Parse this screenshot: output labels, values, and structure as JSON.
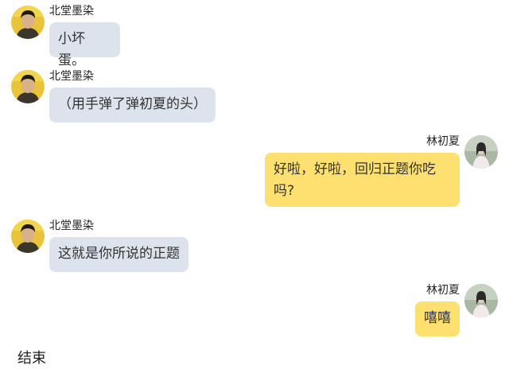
{
  "messages": [
    {
      "side": "left",
      "sender": "北堂墨染",
      "text": "小坏蛋。",
      "avatar_icon": "male-avatar-icon"
    },
    {
      "side": "left",
      "sender": "北堂墨染",
      "text": "（用手弹了弹初夏的头）",
      "avatar_icon": "male-avatar-icon"
    },
    {
      "side": "right",
      "sender": "林初夏",
      "text": "好啦，好啦，回归正题你吃吗?",
      "avatar_icon": "female-avatar-icon"
    },
    {
      "side": "left",
      "sender": "北堂墨染",
      "text": "这就是你所说的正题",
      "avatar_icon": "male-avatar-icon"
    },
    {
      "side": "right",
      "sender": "林初夏",
      "text": "嘻嘻",
      "avatar_icon": "female-avatar-icon"
    }
  ],
  "footer_text": "结束",
  "colors": {
    "left_bubble": "#dde3ec",
    "right_bubble": "#fde070",
    "background": "#ffffff"
  }
}
